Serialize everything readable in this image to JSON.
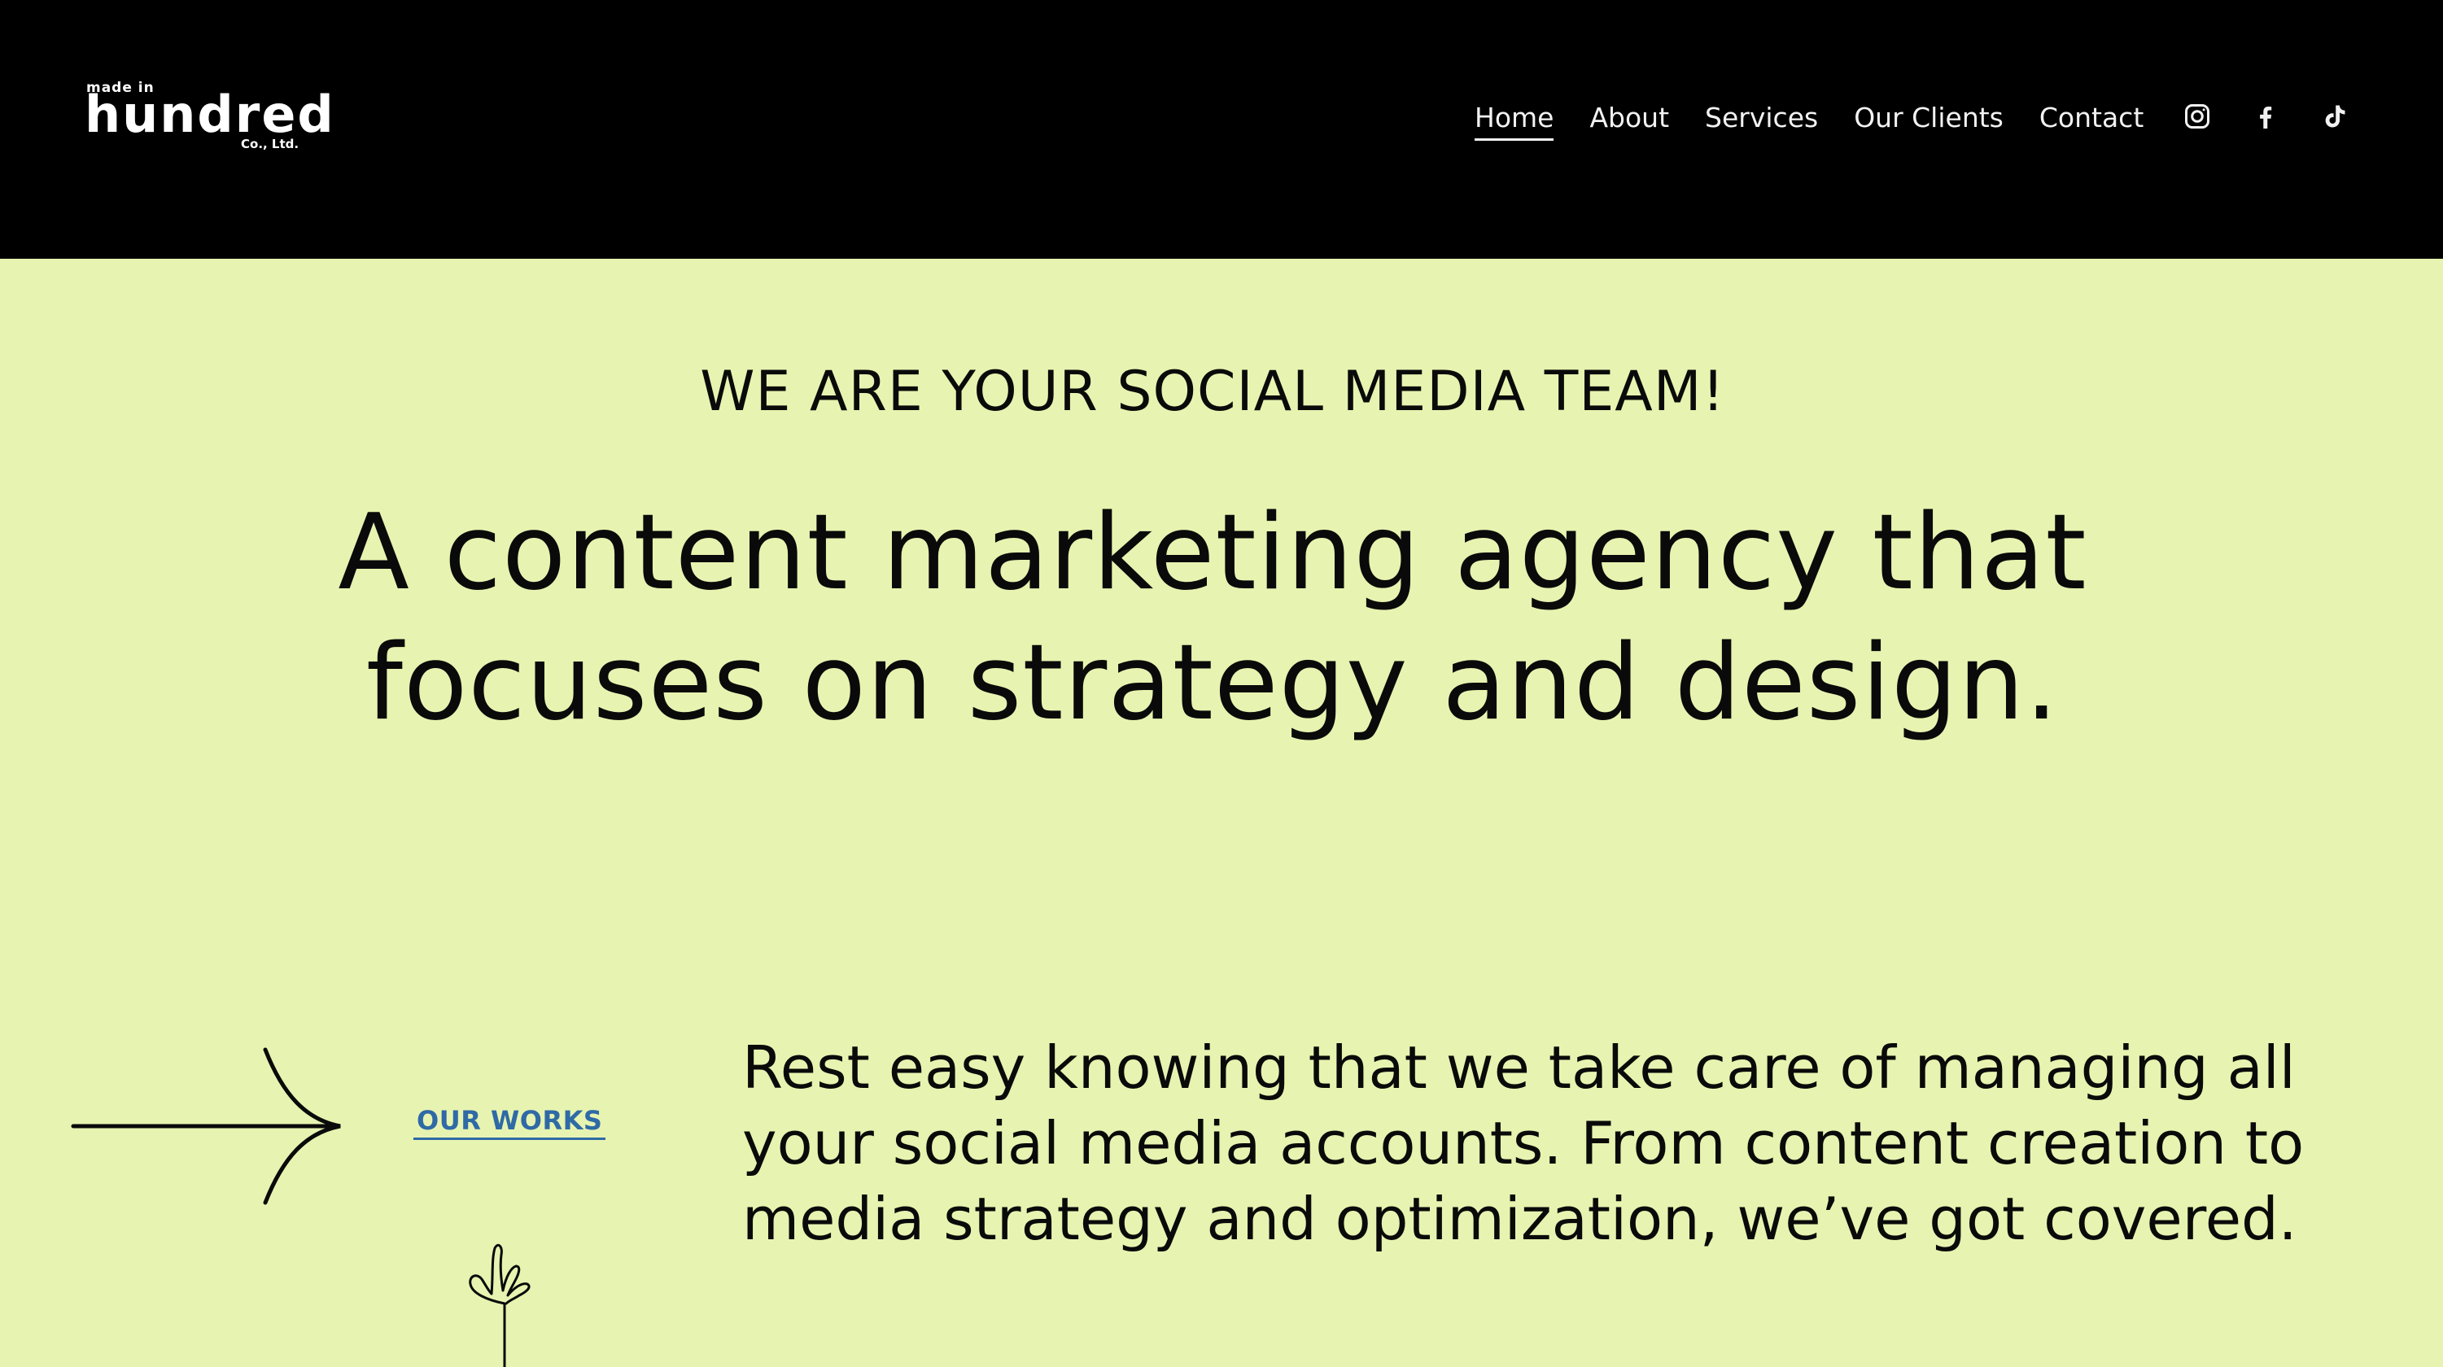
{
  "header": {
    "logo": {
      "top_text": "made in",
      "main_text": "hundred",
      "suffix_text": "Co., Ltd."
    },
    "nav": [
      {
        "label": "Home",
        "active": true
      },
      {
        "label": "About",
        "active": false
      },
      {
        "label": "Services",
        "active": false
      },
      {
        "label": "Our Clients",
        "active": false
      },
      {
        "label": "Contact",
        "active": false
      }
    ],
    "social": [
      {
        "icon": "instagram-icon"
      },
      {
        "icon": "facebook-icon"
      },
      {
        "icon": "tiktok-icon"
      }
    ]
  },
  "hero": {
    "eyebrow": "WE ARE YOUR SOCIAL MEDIA TEAM!",
    "headline_line1": "A content marketing agency that",
    "headline_line2_prefix": "focuses on ",
    "headline_line2_highlight": "strategy and design."
  },
  "section": {
    "link_label": "OUR WORKS",
    "body_lines": [
      "Rest easy knowing that we take care of managing all",
      "your social media accounts. From content creation to",
      "media strategy and optimization, we’ve got covered."
    ]
  },
  "colors": {
    "background": "#e7f3b0",
    "header": "#000000",
    "accent": "#2f6aa6",
    "text": "#0a0a0a"
  }
}
